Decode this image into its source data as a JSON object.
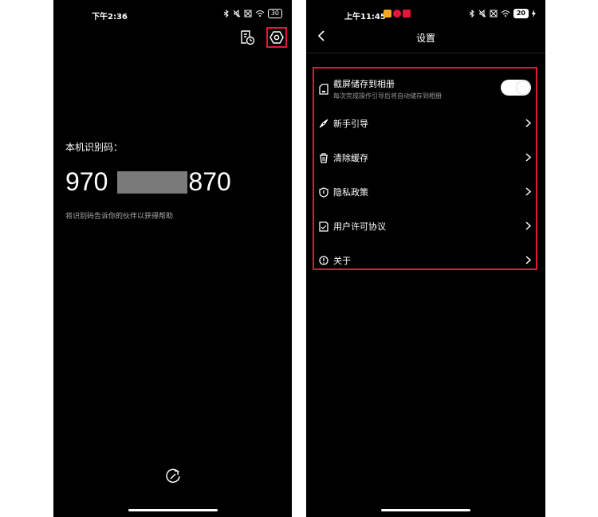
{
  "left": {
    "status_time": "下午2:36",
    "battery": "30",
    "code_label": "本机识别码：",
    "code_prefix": "970",
    "code_suffix": "870",
    "code_hint": "将识别码告诉你的伙伴以获得帮助"
  },
  "right": {
    "status_time": "上午11:45",
    "battery": "20",
    "title": "设置",
    "items": [
      {
        "label": "截屏储存到相册",
        "sub": "每次完成操作引导后将自动储存到相册"
      },
      {
        "label": "新手引导"
      },
      {
        "label": "清除缓存"
      },
      {
        "label": "隐私政策"
      },
      {
        "label": "用户许可协议"
      },
      {
        "label": "关于"
      }
    ]
  },
  "colors": {
    "highlight": "#e4173a",
    "background": "#000000"
  }
}
